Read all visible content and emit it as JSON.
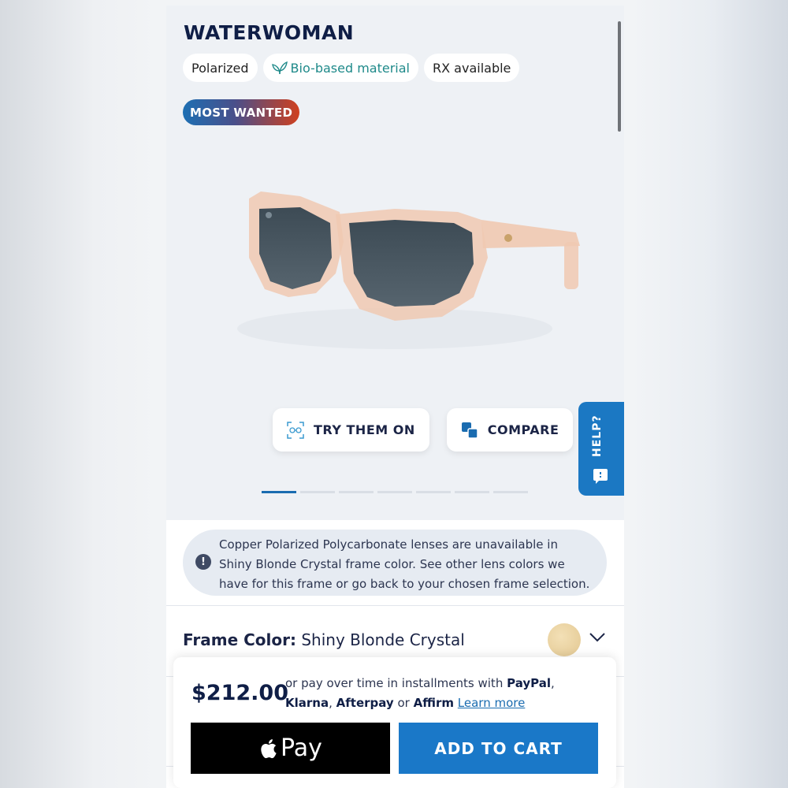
{
  "product": {
    "title": "WATERWOMAN",
    "chips": [
      {
        "label": "Polarized",
        "icon": ""
      },
      {
        "label": "Bio-based material",
        "icon": "leaf-icon"
      },
      {
        "label": "RX available",
        "icon": ""
      }
    ],
    "badge": "MOST WANTED"
  },
  "actions": {
    "try_on": "TRY THEM ON",
    "compare": "COMPARE"
  },
  "help": {
    "label": "HELP?"
  },
  "carousel": {
    "total": 7,
    "active": 1
  },
  "notice": {
    "text": "Copper Polarized Polycarbonate lenses are unavailable in Shiny Blonde Crystal frame color. See other lens colors we have for this frame or go back to your chosen frame selection."
  },
  "frame": {
    "label": "Frame Color:",
    "value": "Shiny Blonde Crystal",
    "swatch_color": "#e3c892"
  },
  "cart": {
    "price": "$212.00",
    "installments_prefix": "or pay over time in installments with",
    "providers": [
      "PayPal",
      "Klarna",
      "Afterpay",
      "Affirm"
    ],
    "separator_comma": ",",
    "separator_or": "or",
    "learn_more": "Learn more",
    "apple_pay": "Pay",
    "add_to_cart": "ADD TO CART"
  },
  "colors": {
    "accent": "#1a78c8",
    "title": "#0f1e46",
    "bio_green": "#1f8a8a"
  }
}
